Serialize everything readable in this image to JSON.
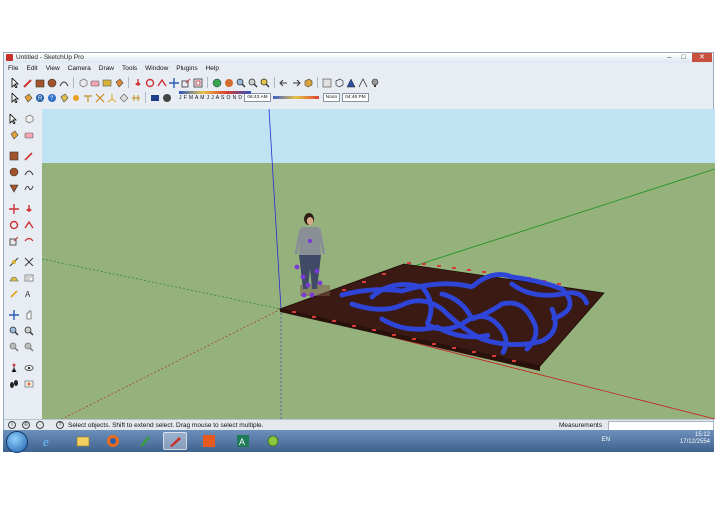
{
  "window": {
    "title": "Untitled - SketchUp Pro",
    "controls": [
      "–",
      "□",
      "✕"
    ]
  },
  "menu": [
    "File",
    "Edit",
    "View",
    "Camera",
    "Draw",
    "Tools",
    "Window",
    "Plugins",
    "Help"
  ],
  "shadow": {
    "months": "J F M A M J J A S O N D",
    "time_start": "06:43 AM",
    "time_mid": "Noon",
    "time_end": "04:46 PM"
  },
  "status": {
    "hint": "Select objects. Shift to extend select. Drag mouse to select multiple.",
    "measurements_label": "Measurements",
    "measurements_value": ""
  },
  "taskbar": {
    "language": "EN",
    "time": "15:12",
    "date": "17/12/2554"
  },
  "colors": {
    "sky": "#bfe3f2",
    "ground": "#95b27d",
    "mat": "#3a1a12",
    "path": "#2f45d8",
    "accent_blue": "#1f5fa8"
  },
  "icons": {
    "toolbar_row1": [
      "select-icon",
      "pencil-icon",
      "rectangle-icon",
      "circle-icon",
      "arc-icon",
      "make-component-icon",
      "eraser-icon",
      "tape-measure-icon",
      "paint-bucket-icon",
      "push-pull-icon",
      "rotate-icon",
      "follow-me-icon",
      "move-icon",
      "scale-icon",
      "offset-icon",
      "orbit-icon",
      "pan-icon",
      "zoom-icon",
      "zoom-window-icon",
      "zoom-extents-icon",
      "previous-view-icon",
      "next-view-icon",
      "standard-views-icon",
      "xray-icon",
      "wireframe-icon",
      "hidden-line-icon",
      "shaded-icon",
      "textured-icon",
      "monochrome-icon"
    ],
    "toolbar_row2": [
      "select-icon",
      "paint-icon",
      "walk-icon",
      "orbit-icon",
      "look-around-icon",
      "position-camera-icon",
      "section-plane-icon",
      "dimension-icon",
      "text-icon",
      "axes-icon",
      "3d-text-icon",
      "shadow-settings-icon",
      "display-shadows-icon"
    ]
  }
}
